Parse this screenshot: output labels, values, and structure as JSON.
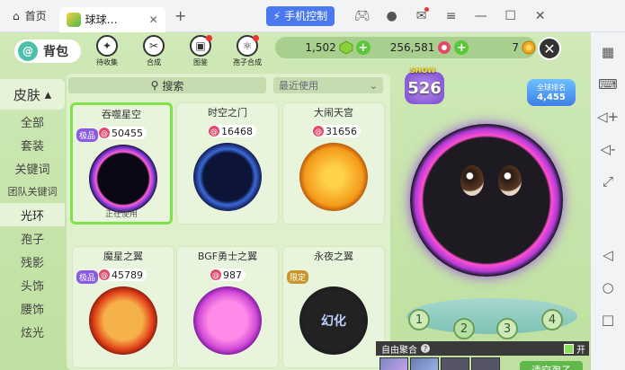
{
  "titlebar": {
    "home_label": "首页",
    "tab_title": "球球…",
    "tab_close": "✕",
    "add_tab": "+",
    "control_label": "手机控制",
    "icons": [
      "gamepad-icon",
      "user-icon",
      "mail-icon",
      "menu-icon",
      "minimize-icon",
      "maximize-icon",
      "close-icon"
    ]
  },
  "header": {
    "bag_label": "背包",
    "menu": [
      {
        "label": "待收集",
        "glyph": "✦"
      },
      {
        "label": "合成",
        "glyph": "✂"
      },
      {
        "label": "图鉴",
        "glyph": "▣"
      },
      {
        "label": "孢子合成",
        "glyph": "⚛"
      }
    ],
    "currency": [
      {
        "value": "1,502",
        "color": "#8ad23a"
      },
      {
        "value": "256,581",
        "color": "#e24a6a"
      },
      {
        "value": "7",
        "color": "#f1a81f"
      }
    ],
    "plus": "+",
    "close": "✕"
  },
  "categories": {
    "head": "皮肤",
    "items": [
      "全部",
      "套装",
      "关键词",
      "团队关键词",
      "光环",
      "孢子",
      "残影",
      "头饰",
      "腰饰",
      "炫光"
    ],
    "selected": "光环"
  },
  "panel": {
    "search": "搜索",
    "sort": "最近使用",
    "cards": [
      {
        "name": "吞噬星空",
        "price": "50455",
        "tag": "极品",
        "status": "正在使用"
      },
      {
        "name": "时空之门",
        "price": "16468"
      },
      {
        "name": "大闹天宫",
        "price": "31656"
      },
      {
        "name": "魔星之翼",
        "price": "45789",
        "tag": "极品"
      },
      {
        "name": "BGF勇士之翼",
        "price": "987"
      },
      {
        "name": "永夜之翼",
        "price": "",
        "tag": "限定",
        "overlay": "幻化"
      }
    ]
  },
  "preview": {
    "level": "526",
    "level_tag": "SHOW",
    "rank_label": "全球排名",
    "rank_value": "4,455",
    "slots": [
      "1",
      "2",
      "3",
      "4"
    ],
    "free_label": "自由聚合",
    "free_toggle": "开",
    "clear_button": "清空孢子"
  },
  "android": {
    "buttons": [
      "grid-icon",
      "keyboard-icon",
      "volume-up-icon",
      "volume-down-icon",
      "expand-icon",
      "back-icon",
      "home-icon",
      "recents-icon"
    ]
  }
}
